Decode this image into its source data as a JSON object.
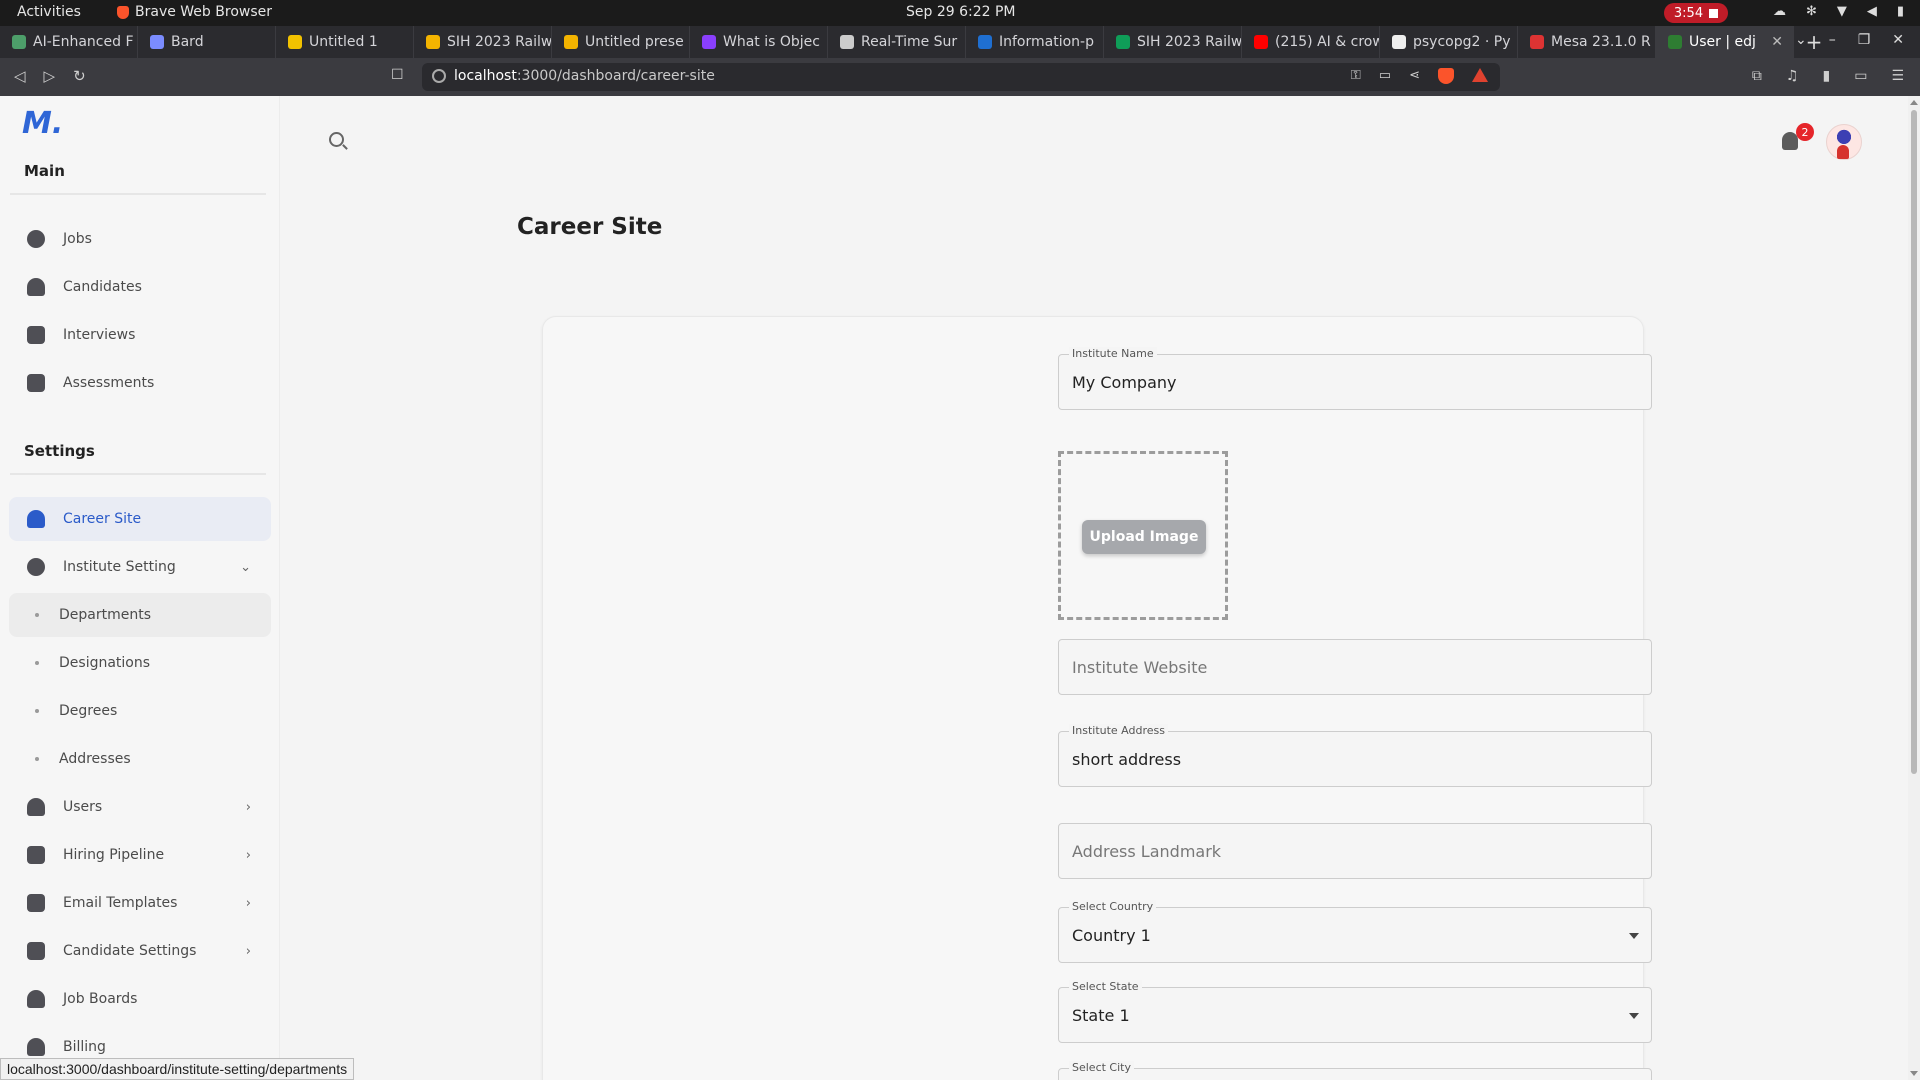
{
  "system": {
    "activities": "Activities",
    "app_name": "Brave Web Browser",
    "clock": "Sep 29  6:22 PM",
    "recording_time": "3:54"
  },
  "tabs": [
    {
      "label": "AI-Enhanced F",
      "color": "#4d9e6a"
    },
    {
      "label": "Bard",
      "color": "#7b8cff"
    },
    {
      "label": "Untitled 1",
      "color": "#f2c200"
    },
    {
      "label": "SIH 2023 Railw",
      "color": "#f4b400"
    },
    {
      "label": "Untitled prese",
      "color": "#f4b400"
    },
    {
      "label": "What is Objec",
      "color": "#8a3ffc"
    },
    {
      "label": "Real-Time Sur",
      "color": "#cccccc"
    },
    {
      "label": "Information-p",
      "color": "#1f6fd1"
    },
    {
      "label": "SIH 2023 Railw",
      "color": "#0f9d58"
    },
    {
      "label": "(215) AI & crow",
      "color": "#ff0000"
    },
    {
      "label": "psycopg2 · Py",
      "color": "#eeeeee"
    },
    {
      "label": "Mesa 23.1.0 R",
      "color": "#d33"
    },
    {
      "label": "User | edj",
      "color": "#2e7d32"
    }
  ],
  "address_bar": {
    "host": "localhost",
    "path": ":3000/dashboard/career-site"
  },
  "sidebar": {
    "logo": "M.",
    "main_title": "Main",
    "main_items": [
      {
        "label": "Jobs",
        "icon": "pie-chart-icon"
      },
      {
        "label": "Candidates",
        "icon": "people-icon"
      },
      {
        "label": "Interviews",
        "icon": "calendar-icon"
      },
      {
        "label": "Assessments",
        "icon": "document-icon"
      }
    ],
    "settings_title": "Settings",
    "settings_items": [
      {
        "label": "Career Site",
        "icon": "person-add-icon",
        "active": true
      },
      {
        "label": "Institute Setting",
        "icon": "pie-chart-icon",
        "expanded": true
      },
      {
        "label": "Departments",
        "sub": true
      },
      {
        "label": "Designations",
        "sub": true
      },
      {
        "label": "Degrees",
        "sub": true
      },
      {
        "label": "Addresses",
        "sub": true
      },
      {
        "label": "Users",
        "icon": "people-icon"
      },
      {
        "label": "Hiring Pipeline",
        "icon": "calendar-icon"
      },
      {
        "label": "Email Templates",
        "icon": "document-icon"
      },
      {
        "label": "Candidate Settings",
        "icon": "lock-icon"
      },
      {
        "label": "Job Boards",
        "icon": "person-add-icon"
      },
      {
        "label": "Billing",
        "icon": "person-add-icon"
      }
    ]
  },
  "header": {
    "notification_count": "2"
  },
  "page": {
    "title": "Career Site",
    "form": {
      "institute_name_label": "Institute Name",
      "institute_name_value": "My Company",
      "upload_button": "Upload Image",
      "website_placeholder": "Institute Website",
      "address_label": "Institute Address",
      "address_value": "short address",
      "landmark_placeholder": "Address Landmark",
      "country_label": "Select Country",
      "country_value": "Country 1",
      "state_label": "Select State",
      "state_value": "State 1",
      "city_label": "Select City"
    }
  },
  "status_bar_url": "localhost:3000/dashboard/institute-setting/departments"
}
